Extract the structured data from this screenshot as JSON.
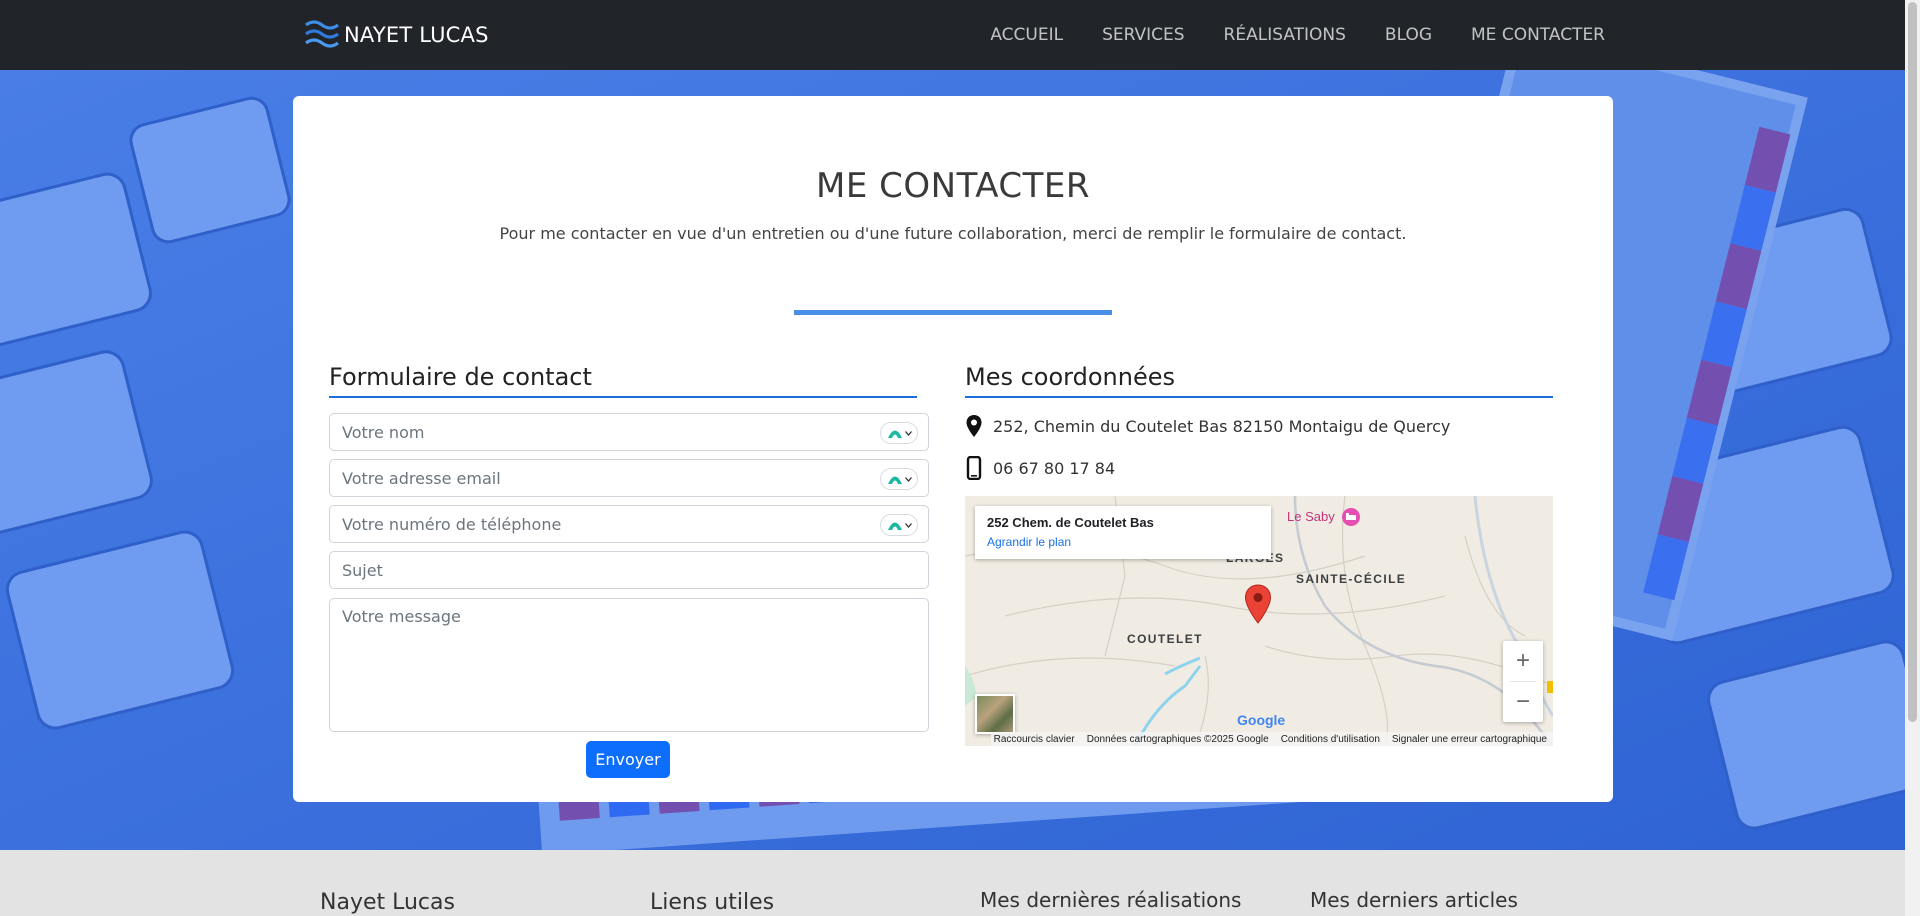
{
  "nav": {
    "brand": "NAYET LUCAS",
    "links": [
      "ACCUEIL",
      "SERVICES",
      "RÉALISATIONS",
      "BLOG",
      "ME CONTACTER"
    ]
  },
  "contact": {
    "title": "ME CONTACTER",
    "subtitle": "Pour me contacter en vue d'un entretien ou d'une future collaboration, merci de remplir le formulaire de contact."
  },
  "form": {
    "title": "Formulaire de contact",
    "name_placeholder": "Votre nom",
    "email_placeholder": "Votre adresse email",
    "phone_placeholder": "Votre numéro de téléphone",
    "subject_placeholder": "Sujet",
    "message_placeholder": "Votre message",
    "submit_label": "Envoyer"
  },
  "details": {
    "title": "Mes coordonnées",
    "address": "252, Chemin du Coutelet Bas 82150 Montaigu de Quercy",
    "phone": "06 67 80 17 84"
  },
  "map": {
    "place_title": "252 Chem. de Coutelet Bas",
    "enlarge_link": "Agrandir le plan",
    "poi": "Le Saby",
    "labels": [
      "LARGES",
      "SAINTE-CÉCILE",
      "COUTELET"
    ],
    "zoom_in": "+",
    "zoom_out": "−",
    "logo": "Google",
    "footer": [
      "Raccourcis clavier",
      "Données cartographiques ©2025 Google",
      "Conditions d'utilisation",
      "Signaler une erreur cartographique"
    ],
    "pin_color": "#ea4335"
  },
  "footer": {
    "col1": "Nayet Lucas",
    "col2": "Liens utiles",
    "col3": "Mes dernières réalisations",
    "col4": "Mes derniers articles"
  },
  "colors": {
    "navbar": "#212529",
    "accent": "#0d6efd",
    "hero_blue": "#3a6fe0"
  }
}
